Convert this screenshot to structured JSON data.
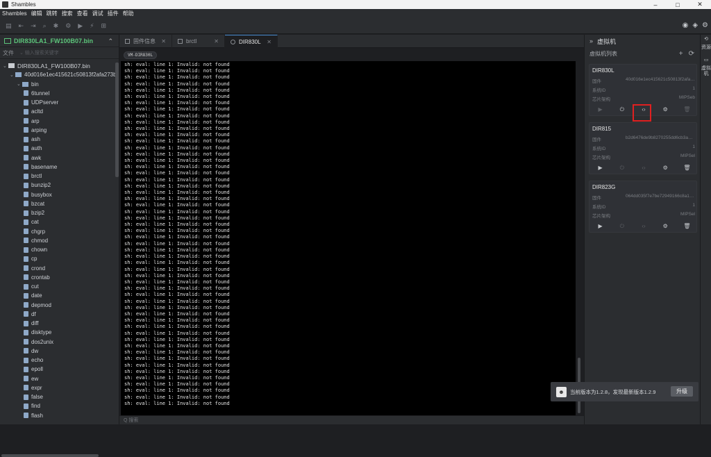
{
  "window": {
    "title": "Shambles",
    "minimize": "–",
    "maximize": "□",
    "close": "✕"
  },
  "menu": [
    "Shambles",
    "编辑",
    "跳转",
    "搜索",
    "查看",
    "调试",
    "插件",
    "帮助"
  ],
  "left": {
    "project": "DIR830LA1_FW100B07.bin",
    "search_label": "文件",
    "search_placeholder": "输入搜索关键字",
    "root": "DIR830LA1_FW100B07.bin",
    "hash_folder": "40d016e1ec415621c50813f2afa273b",
    "bin_folder": "bin",
    "files": [
      "6tunnel",
      "UDPserver",
      "acltd",
      "arp",
      "arping",
      "ash",
      "auth",
      "awk",
      "basename",
      "brctl",
      "bunzip2",
      "busybox",
      "bzcat",
      "bzip2",
      "cat",
      "chgrp",
      "chmod",
      "chown",
      "cp",
      "crond",
      "crontab",
      "cut",
      "date",
      "depmod",
      "df",
      "diff",
      "disktype",
      "dos2unix",
      "dw",
      "echo",
      "epoll",
      "ew",
      "expr",
      "false",
      "find",
      "flash"
    ]
  },
  "tabs": [
    {
      "label": "固件信息",
      "active": false
    },
    {
      "label": "brctl",
      "active": false
    },
    {
      "label": "DIR830L",
      "active": true
    }
  ],
  "terminal": {
    "tag": "VM-DIR830L",
    "line": "sh: eval: line 1: Invalid: not found",
    "count": 54
  },
  "command_placeholder": "Q 搜索",
  "right": {
    "title": "虚拟机",
    "list_label": "虚拟机列表",
    "add_icon": "+",
    "refresh_icon": "⟳",
    "vms": [
      {
        "name": "DIR830L",
        "firmware_label": "固件",
        "firmware": "40d016e1ec415621c50813f2afa273b",
        "sysid_label": "系统ID",
        "sysid": "1",
        "arch_label": "芯片架构",
        "arch": "MIPSeb",
        "running": true
      },
      {
        "name": "DIR815",
        "firmware_label": "固件",
        "firmware": "b2d6476de9b8270255dd6cb3a1f2c4e",
        "sysid_label": "系统ID",
        "sysid": "1",
        "arch_label": "芯片架构",
        "arch": "MIPSel",
        "running": false
      },
      {
        "name": "DIR823G",
        "firmware_label": "固件",
        "firmware": "064dd035f7e7be72949166c8a1d2b33",
        "sysid_label": "系统ID",
        "sysid": "1",
        "arch_label": "芯片架构",
        "arch": "MIPSel",
        "running": false
      }
    ]
  },
  "side_tabs": [
    "资源",
    "虚拟机"
  ],
  "toast": {
    "message": "当前版本为1.2.8，发现最新版本1.2.9",
    "button": "升级"
  }
}
